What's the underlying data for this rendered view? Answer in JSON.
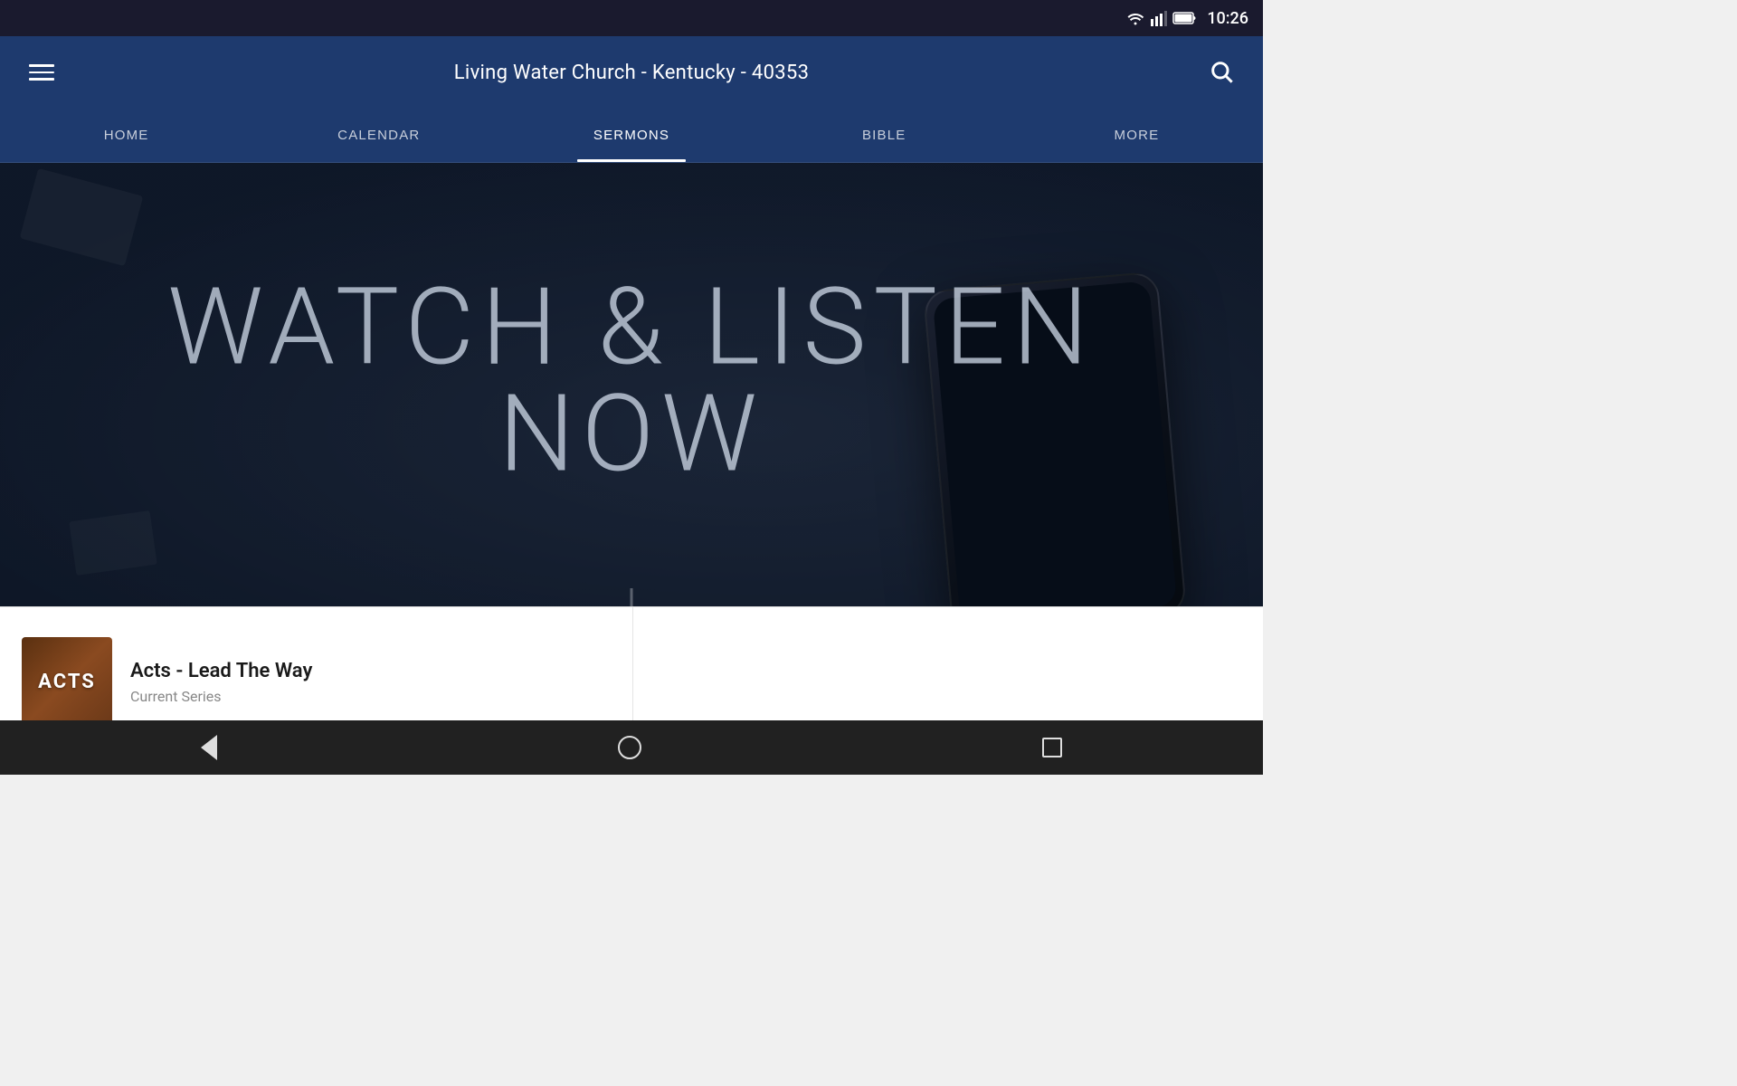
{
  "statusBar": {
    "time": "10:26"
  },
  "appBar": {
    "title": "Living Water Church - Kentucky - 40353"
  },
  "navTabs": [
    {
      "id": "home",
      "label": "HOME",
      "active": false
    },
    {
      "id": "calendar",
      "label": "CALENDAR",
      "active": false
    },
    {
      "id": "sermons",
      "label": "SERMONS",
      "active": true
    },
    {
      "id": "bible",
      "label": "BIBLE",
      "active": false
    },
    {
      "id": "more",
      "label": "MORE",
      "active": false
    }
  ],
  "hero": {
    "headline_line1": "WATCH & LISTEN",
    "headline_line2": "NOW"
  },
  "seriesCard": {
    "thumbnail_label": "ACTS",
    "title": "Acts - Lead The Way",
    "subtitle": "Current Series"
  },
  "bottomNav": {
    "back_label": "back",
    "home_label": "home",
    "recent_label": "recent"
  }
}
